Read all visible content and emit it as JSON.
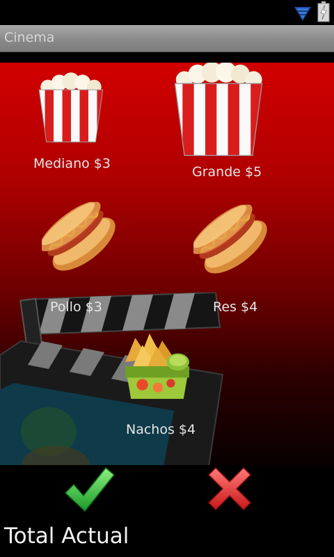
{
  "app": {
    "title": "Cinema"
  },
  "status_bar": {
    "icons": [
      "wifi-icon",
      "battery-charging-icon"
    ]
  },
  "menu": [
    {
      "label": "Mediano $3",
      "icon": "popcorn-medium-icon"
    },
    {
      "label": "Grande $5",
      "icon": "popcorn-large-icon"
    },
    {
      "label": "Pollo $3",
      "icon": "hotdog-icon"
    },
    {
      "label": "Res $4",
      "icon": "hotdog-icon"
    },
    {
      "label": "Nachos $4",
      "icon": "nachos-icon"
    }
  ],
  "actions": {
    "confirm_icon": "checkmark-icon",
    "cancel_icon": "cross-icon"
  },
  "footer": {
    "total_label": "Total Actual"
  },
  "colors": {
    "background_red": "#d10000",
    "title_bar": "#9a9a9a",
    "confirm": "#2ecc40",
    "cancel": "#e02020"
  }
}
